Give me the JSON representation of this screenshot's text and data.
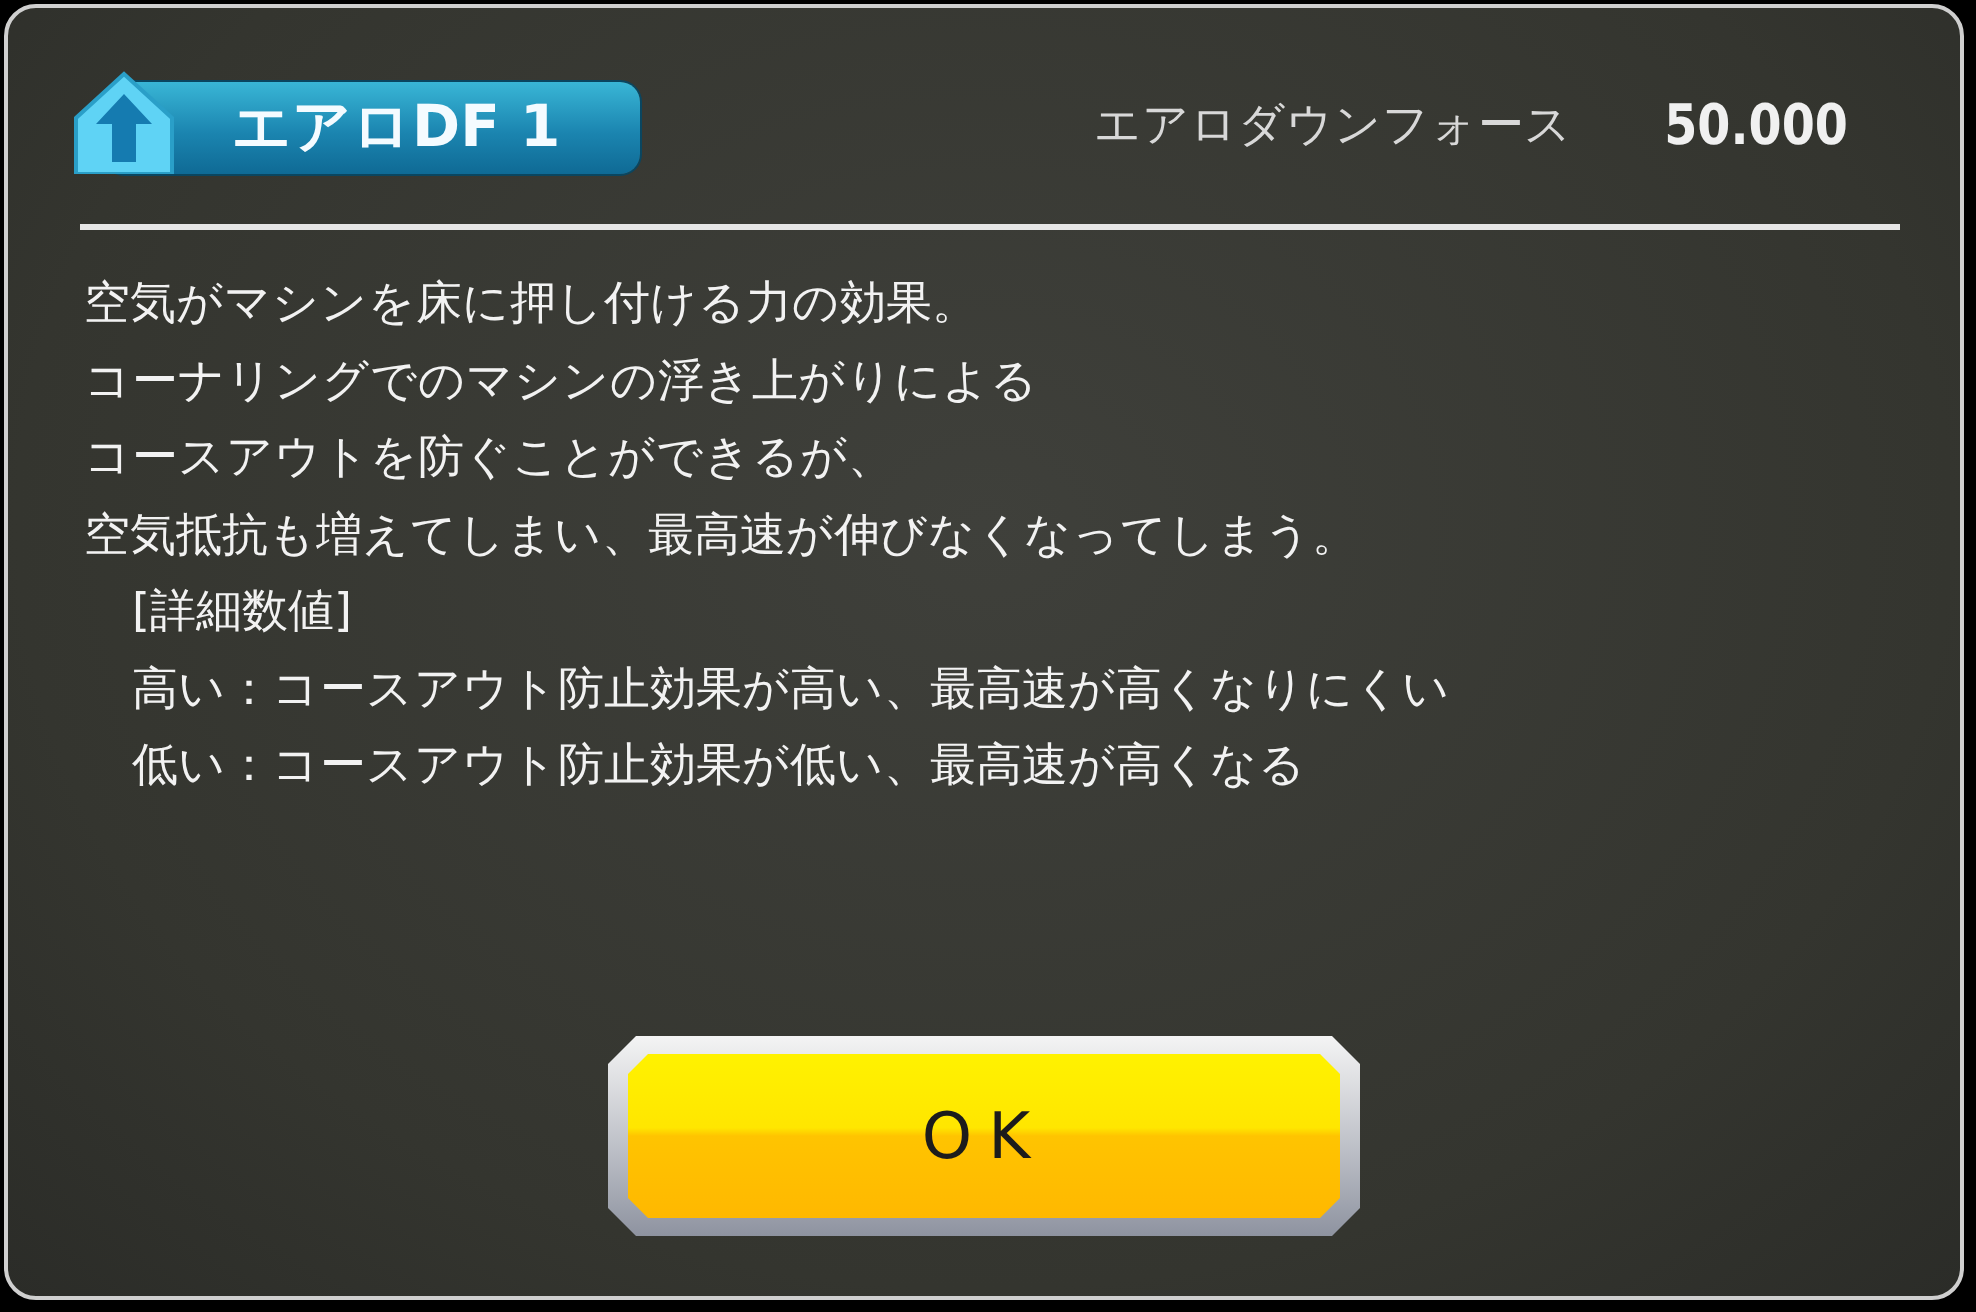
{
  "title": "エアロDF 1",
  "stat": {
    "label": "エアロダウンフォース",
    "value": "50.000"
  },
  "description": [
    "空気がマシンを床に押し付ける力の効果。",
    "コーナリングでのマシンの浮き上がりによる",
    "コースアウトを防ぐことができるが、",
    "空気抵抗も増えてしまい、最高速が伸びなくなってしまう。"
  ],
  "details": [
    "[詳細数値]",
    "高い：コースアウト防止効果が高い、最高速が高くなりにくい",
    "低い：コースアウト防止効果が低い、最高速が高くなる"
  ],
  "ok_button": "OK"
}
